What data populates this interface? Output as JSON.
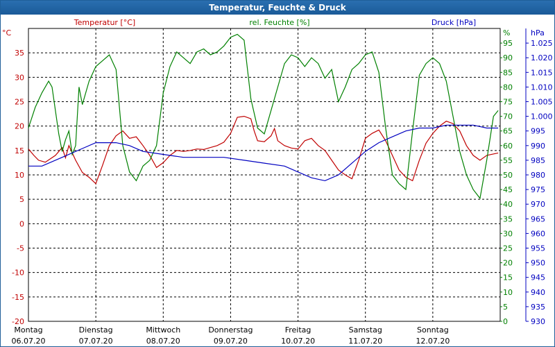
{
  "window": {
    "title": "Temperatur, Feuchte & Druck"
  },
  "colors": {
    "temperature": "#c00000",
    "humidity": "#008000",
    "pressure": "#0000c0",
    "grid": "#000000",
    "title_bar": "#1a5a98"
  },
  "chart_data": {
    "type": "line",
    "grid": true,
    "x_days": [
      {
        "day": "Montag",
        "date": "06.07.20"
      },
      {
        "day": "Dienstag",
        "date": "07.07.20"
      },
      {
        "day": "Mittwoch",
        "date": "08.07.20"
      },
      {
        "day": "Donnerstag",
        "date": "09.07.20"
      },
      {
        "day": "Freitag",
        "date": "10.07.20"
      },
      {
        "day": "Samstag",
        "date": "11.07.20"
      },
      {
        "day": "Sonntag",
        "date": "12.07.20"
      }
    ],
    "axes": {
      "temperature": {
        "label": "Temperatur [°C]",
        "unit": "°C",
        "ylim": [
          -20,
          40
        ],
        "ticks": [
          "35",
          "30",
          "25",
          "20",
          "15",
          "10",
          "5",
          "0",
          "-5",
          "-10",
          "-15",
          "-20"
        ],
        "tick_values": [
          35,
          30,
          25,
          20,
          15,
          10,
          5,
          0,
          -5,
          -10,
          -15,
          -20
        ]
      },
      "humidity": {
        "label": "rel. Feuchte [%]",
        "unit": "%",
        "ylim": [
          0,
          100
        ],
        "ticks": [
          "95",
          "90",
          "85",
          "80",
          "75",
          "70",
          "65",
          "60",
          "55",
          "50",
          "45",
          "40",
          "35",
          "30",
          "25",
          "20",
          "15",
          "10",
          "5",
          "0"
        ],
        "tick_values": [
          95,
          90,
          85,
          80,
          75,
          70,
          65,
          60,
          55,
          50,
          45,
          40,
          35,
          30,
          25,
          20,
          15,
          10,
          5,
          0
        ]
      },
      "pressure": {
        "label": "Druck [hPa]",
        "unit": "hPa",
        "ylim": [
          930,
          1030
        ],
        "ticks": [
          "1.025",
          "1.020",
          "1.015",
          "1.010",
          "1.005",
          "1.000",
          "995",
          "990",
          "985",
          "980",
          "975",
          "970",
          "965",
          "960",
          "955",
          "950",
          "945",
          "940",
          "935",
          "930"
        ],
        "tick_values": [
          1025,
          1020,
          1015,
          1010,
          1005,
          1000,
          995,
          990,
          985,
          980,
          975,
          970,
          965,
          960,
          955,
          950,
          945,
          940,
          935,
          930
        ]
      }
    },
    "series": [
      {
        "name": "Temperatur [°C]",
        "axis": "temperature",
        "x": [
          0,
          0.08,
          0.15,
          0.25,
          0.4,
          0.5,
          0.55,
          0.6,
          0.7,
          0.8,
          0.9,
          1.0,
          1.1,
          1.2,
          1.3,
          1.4,
          1.5,
          1.6,
          1.7,
          1.8,
          1.9,
          2.0,
          2.1,
          2.2,
          2.3,
          2.4,
          2.5,
          2.6,
          2.7,
          2.8,
          2.9,
          3.0,
          3.1,
          3.2,
          3.3,
          3.35,
          3.4,
          3.5,
          3.6,
          3.65,
          3.7,
          3.8,
          3.9,
          4.0,
          4.1,
          4.2,
          4.3,
          4.4,
          4.5,
          4.6,
          4.7,
          4.8,
          4.9,
          5.0,
          5.1,
          5.2,
          5.3,
          5.4,
          5.5,
          5.6,
          5.7,
          5.8,
          5.9,
          6.0,
          6.1,
          6.2,
          6.3,
          6.4,
          6.5,
          6.6,
          6.7,
          6.8,
          6.97
        ],
        "values": [
          15.3,
          14,
          13,
          12.6,
          14,
          15.6,
          13.5,
          16,
          13,
          10.5,
          9.5,
          8.2,
          12,
          16,
          18,
          19,
          17.5,
          17.8,
          16,
          14,
          11.5,
          12.5,
          14,
          15,
          14.8,
          15,
          15.3,
          15.2,
          15.6,
          16,
          16.7,
          18.5,
          21.8,
          22,
          21.5,
          19,
          17,
          16.8,
          18,
          19.5,
          17,
          16,
          15.5,
          15.3,
          17,
          17.5,
          16,
          15,
          13,
          11,
          10,
          9.2,
          13,
          17.5,
          18.5,
          19.2,
          17,
          14,
          11,
          9.5,
          8.8,
          13,
          16.5,
          18.5,
          20,
          21,
          20.5,
          19,
          16,
          14,
          13,
          14,
          14.5
        ]
      },
      {
        "name": "rel. Feuchte [%]",
        "axis": "humidity",
        "x": [
          0,
          0.1,
          0.2,
          0.3,
          0.35,
          0.45,
          0.5,
          0.55,
          0.6,
          0.65,
          0.7,
          0.75,
          0.8,
          0.9,
          1.0,
          1.1,
          1.2,
          1.3,
          1.4,
          1.5,
          1.6,
          1.7,
          1.8,
          1.9,
          2.0,
          2.1,
          2.2,
          2.3,
          2.4,
          2.5,
          2.6,
          2.7,
          2.8,
          2.9,
          3.0,
          3.1,
          3.2,
          3.3,
          3.4,
          3.5,
          3.6,
          3.7,
          3.8,
          3.9,
          4.0,
          4.1,
          4.2,
          4.3,
          4.4,
          4.5,
          4.6,
          4.7,
          4.8,
          4.9,
          5.0,
          5.1,
          5.2,
          5.3,
          5.4,
          5.5,
          5.6,
          5.7,
          5.8,
          5.9,
          6.0,
          6.1,
          6.2,
          6.3,
          6.4,
          6.5,
          6.6,
          6.7,
          6.8,
          6.9,
          6.97
        ],
        "values": [
          66,
          73,
          78,
          82,
          80,
          64,
          58,
          62,
          65,
          57,
          60,
          80,
          74,
          82,
          87,
          89,
          91,
          86,
          60,
          51,
          48,
          53,
          55,
          60,
          78,
          87,
          92,
          90,
          88,
          92,
          93,
          91,
          92,
          94,
          97,
          98,
          96,
          76,
          66,
          64,
          72,
          80,
          88,
          91,
          90,
          87,
          90,
          88,
          83,
          86,
          75,
          80,
          86,
          88,
          91,
          92,
          85,
          66,
          50,
          47,
          45,
          65,
          84,
          88,
          90,
          88,
          82,
          70,
          58,
          50,
          45,
          42,
          55,
          70,
          72
        ]
      },
      {
        "name": "Druck [hPa]",
        "axis": "pressure",
        "x": [
          0,
          0.2,
          0.5,
          0.8,
          1.0,
          1.3,
          1.5,
          1.7,
          2.0,
          2.3,
          2.6,
          2.9,
          3.2,
          3.5,
          3.8,
          4.0,
          4.2,
          4.4,
          4.6,
          4.8,
          5.0,
          5.2,
          5.4,
          5.6,
          5.8,
          6.0,
          6.2,
          6.4,
          6.6,
          6.8,
          6.97
        ],
        "values": [
          983,
          983,
          986,
          989,
          991,
          991,
          990,
          988,
          987,
          986,
          986,
          986,
          985,
          984,
          983,
          981,
          979,
          978,
          980,
          984,
          988,
          991,
          993,
          995,
          996,
          996,
          997,
          997,
          997,
          996,
          996
        ]
      }
    ]
  }
}
